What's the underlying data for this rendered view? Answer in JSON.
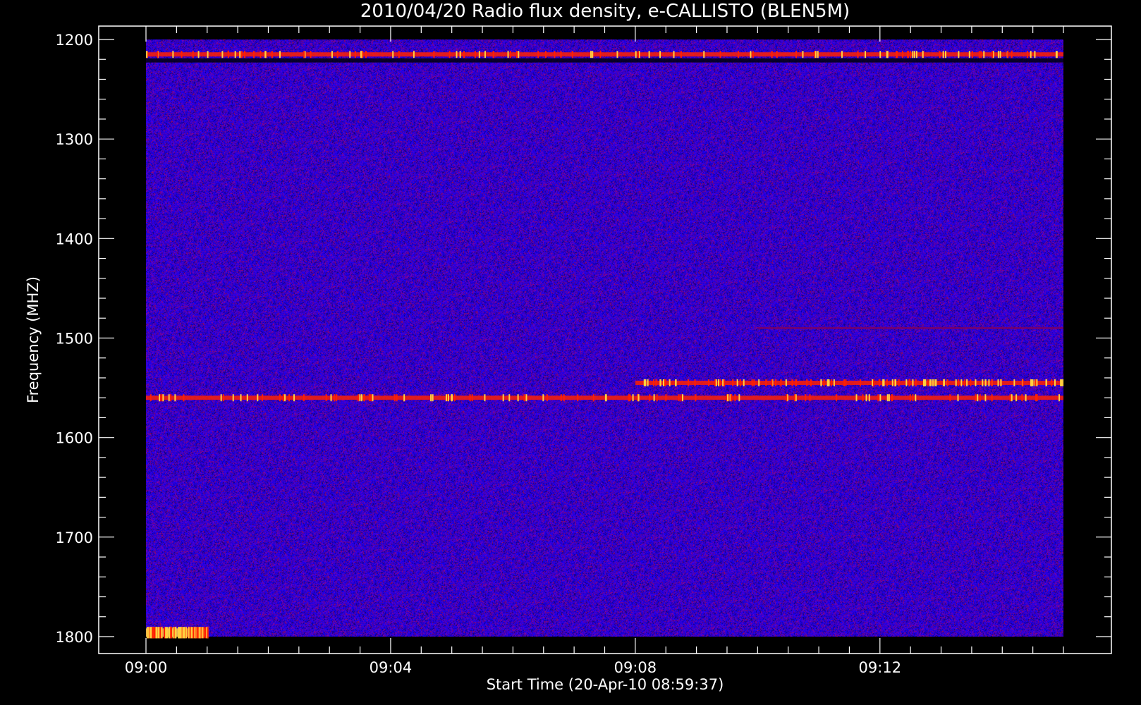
{
  "chart_data": {
    "type": "heatmap",
    "title": "2010/04/20  Radio flux density, e-CALLISTO (BLEN5M)",
    "xlabel": "Start Time (20-Apr-10 08:59:37)",
    "ylabel": "Frequency (MHZ)",
    "x_ticks": [
      "09:00",
      "09:04",
      "09:08",
      "09:12"
    ],
    "y_ticks": [
      "1200",
      "1300",
      "1400",
      "1500",
      "1600",
      "1700",
      "1800"
    ],
    "xlim": [
      "09:00",
      "09:15"
    ],
    "ylim": [
      1200,
      1800
    ],
    "y_inverted": true,
    "colors": {
      "background": "#000000",
      "low": "#0000ff",
      "mid": "#800060",
      "high": "#ff2000",
      "peak": "#ffd040"
    },
    "features": [
      {
        "freq_mhz": 1215,
        "time_start": "09:00",
        "time_end": "09:15",
        "intensity": "high"
      },
      {
        "freq_mhz": 1221,
        "time_start": "09:00",
        "time_end": "09:15",
        "intensity": "low-dark"
      },
      {
        "freq_mhz": 1490,
        "time_start": "09:10",
        "time_end": "09:15",
        "intensity": "mid"
      },
      {
        "freq_mhz": 1545,
        "time_start": "09:08",
        "time_end": "09:15",
        "intensity": "high"
      },
      {
        "freq_mhz": 1560,
        "time_start": "09:00",
        "time_end": "09:15",
        "intensity": "high"
      },
      {
        "freq_mhz": 1796,
        "time_start": "09:00",
        "time_end": "09:01",
        "intensity": "peak"
      }
    ]
  }
}
